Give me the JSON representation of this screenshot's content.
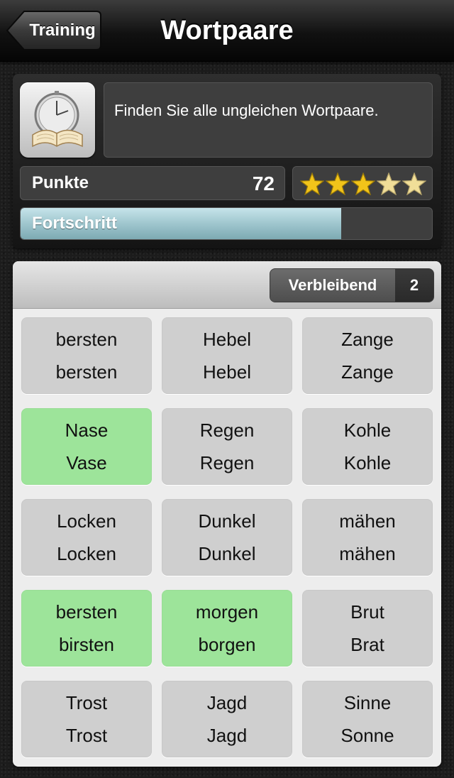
{
  "nav": {
    "back_label": "Training",
    "title": "Wortpaare"
  },
  "info": {
    "icon": "clock-book-icon",
    "description": "Finden Sie alle ungleichen Wortpaare.",
    "score_label": "Punkte",
    "score_value": "72",
    "stars_total": 5,
    "stars_filled": 3,
    "progress_label": "Fortschritt",
    "progress_fraction": 0.78
  },
  "game": {
    "remaining_label": "Verbleibend",
    "remaining_value": "2",
    "cards": [
      {
        "top": "bersten",
        "bottom": "bersten",
        "highlight": false
      },
      {
        "top": "Hebel",
        "bottom": "Hebel",
        "highlight": false
      },
      {
        "top": "Zange",
        "bottom": "Zange",
        "highlight": false
      },
      {
        "top": "Nase",
        "bottom": "Vase",
        "highlight": true
      },
      {
        "top": "Regen",
        "bottom": "Regen",
        "highlight": false
      },
      {
        "top": "Kohle",
        "bottom": "Kohle",
        "highlight": false
      },
      {
        "top": "Locken",
        "bottom": "Locken",
        "highlight": false
      },
      {
        "top": "Dunkel",
        "bottom": "Dunkel",
        "highlight": false
      },
      {
        "top": "mähen",
        "bottom": "mähen",
        "highlight": false
      },
      {
        "top": "bersten",
        "bottom": "birsten",
        "highlight": true
      },
      {
        "top": "morgen",
        "bottom": "borgen",
        "highlight": true
      },
      {
        "top": "Brut",
        "bottom": "Brat",
        "highlight": false
      },
      {
        "top": "Trost",
        "bottom": "Trost",
        "highlight": false
      },
      {
        "top": "Jagd",
        "bottom": "Jagd",
        "highlight": false
      },
      {
        "top": "Sinne",
        "bottom": "Sonne",
        "highlight": false
      }
    ]
  },
  "colors": {
    "card": "#cfcfcf",
    "card_highlight": "#9de49a",
    "progress": "#9fc6ce",
    "star_filled": "#f2c41a",
    "star_light": "#f1de98"
  }
}
